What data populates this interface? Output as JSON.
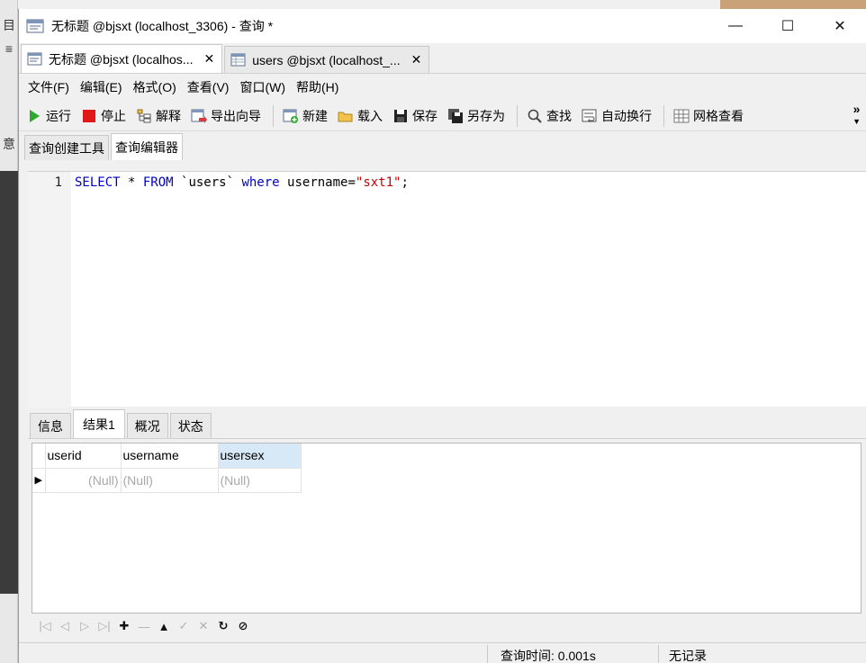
{
  "window": {
    "title": "无标题 @bjsxt (localhost_3306) - 查询 *",
    "minimize": "—",
    "maximize": "☐",
    "close": "✕"
  },
  "background_glyphs": [
    "目",
    "≡",
    "意"
  ],
  "doc_tabs": [
    {
      "label": "无标题 @bjsxt (localhos...",
      "close": "✕",
      "icon": "query-icon"
    },
    {
      "label": "users @bjsxt (localhost_...",
      "close": "✕",
      "icon": "table-icon"
    }
  ],
  "menu": [
    "文件(F)",
    "编辑(E)",
    "格式(O)",
    "查看(V)",
    "窗口(W)",
    "帮助(H)"
  ],
  "toolbar": {
    "run": "运行",
    "stop": "停止",
    "explain": "解释",
    "export_wizard": "导出向导",
    "new": "新建",
    "load": "载入",
    "save": "保存",
    "save_as": "另存为",
    "find": "查找",
    "word_wrap": "自动换行",
    "grid_view": "网格查看",
    "more": "»"
  },
  "sub_tabs": [
    "查询创建工具",
    "查询编辑器"
  ],
  "editor": {
    "line_number": "1",
    "sql": {
      "kw1": "SELECT",
      "p1": " * ",
      "kw2": "FROM",
      "p2": " `users` ",
      "kw3": "where",
      "p3": " username=",
      "str": "\"sxt1\"",
      "p4": ";"
    }
  },
  "result_tabs": [
    "信息",
    "结果1",
    "概况",
    "状态"
  ],
  "grid": {
    "columns": [
      "userid",
      "username",
      "usersex"
    ],
    "rows": [
      [
        "(Null)",
        "(Null)",
        "(Null)"
      ]
    ],
    "row_indicator": "▶"
  },
  "grid_nav": [
    "|◁",
    "◁",
    "▷",
    "▷|",
    "✚",
    "—",
    "▲",
    "✓",
    "✕",
    "↻",
    "⊘"
  ],
  "status": {
    "query_time": "查询时间: 0.001s",
    "records": "无记录"
  }
}
